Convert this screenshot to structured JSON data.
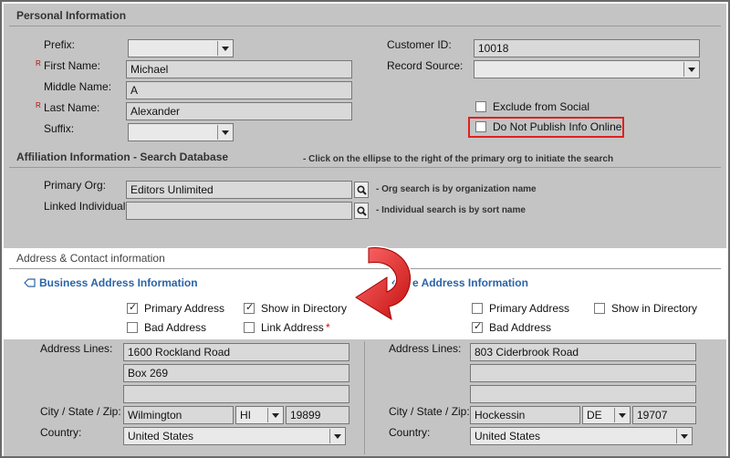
{
  "personal": {
    "header": "Personal Information",
    "prefix_label": "Prefix:",
    "prefix_value": "",
    "first_label": "First Name:",
    "first_value": "Michael",
    "middle_label": "Middle Name:",
    "middle_value": "A",
    "last_label": "Last Name:",
    "last_value": "Alexander",
    "suffix_label": "Suffix:",
    "suffix_value": "",
    "required_mark": "R",
    "customer_id_label": "Customer ID:",
    "customer_id_value": "10018",
    "record_source_label": "Record Source:",
    "record_source_value": "",
    "exclude_social_label": "Exclude from Social",
    "exclude_social_checked": false,
    "dnp_label": "Do Not Publish Info Online",
    "dnp_checked": false
  },
  "affiliation": {
    "header": "Affiliation Information - Search Database",
    "hint": "- Click on the ellipse to the right of the primary org to initiate the search",
    "primary_org_label": "Primary Org:",
    "primary_org_value": "Editors Unlimited",
    "primary_org_note": "- Org search is by organization name",
    "linked_label": "Linked Individual:",
    "linked_value": "",
    "linked_note": "- Individual search is by sort name"
  },
  "address": {
    "header": "Address & Contact information",
    "business": {
      "title": "Business Address Information",
      "primary_label": "Primary Address",
      "primary_checked": true,
      "show_dir_label": "Show in Directory",
      "show_dir_checked": true,
      "bad_label": "Bad Address",
      "bad_checked": false,
      "link_label": "Link Address",
      "link_required": "*",
      "link_checked": false,
      "lines_label": "Address Lines:",
      "line1": "1600 Rockland Road",
      "line2": "Box 269",
      "line3": "",
      "csz_label": "City / State / Zip:",
      "city": "Wilmington",
      "state": "HI",
      "zip": "19899",
      "country_label": "Country:",
      "country": "United States"
    },
    "home": {
      "title": "e Address Information",
      "primary_label": "Primary Address",
      "primary_checked": false,
      "show_dir_label": "Show in Directory",
      "show_dir_checked": false,
      "bad_label": "Bad Address",
      "bad_checked": true,
      "lines_label": "Address Lines:",
      "line1": "803 Ciderbrook Road",
      "line2": "",
      "line3": "",
      "csz_label": "City / State / Zip:",
      "city": "Hockessin",
      "state": "DE",
      "zip": "19707",
      "country_label": "Country:",
      "country": "United States"
    }
  },
  "colors": {
    "panel_gray": "#c4c4c4",
    "highlight_red": "#e02020",
    "link_blue": "#2a64a8"
  }
}
